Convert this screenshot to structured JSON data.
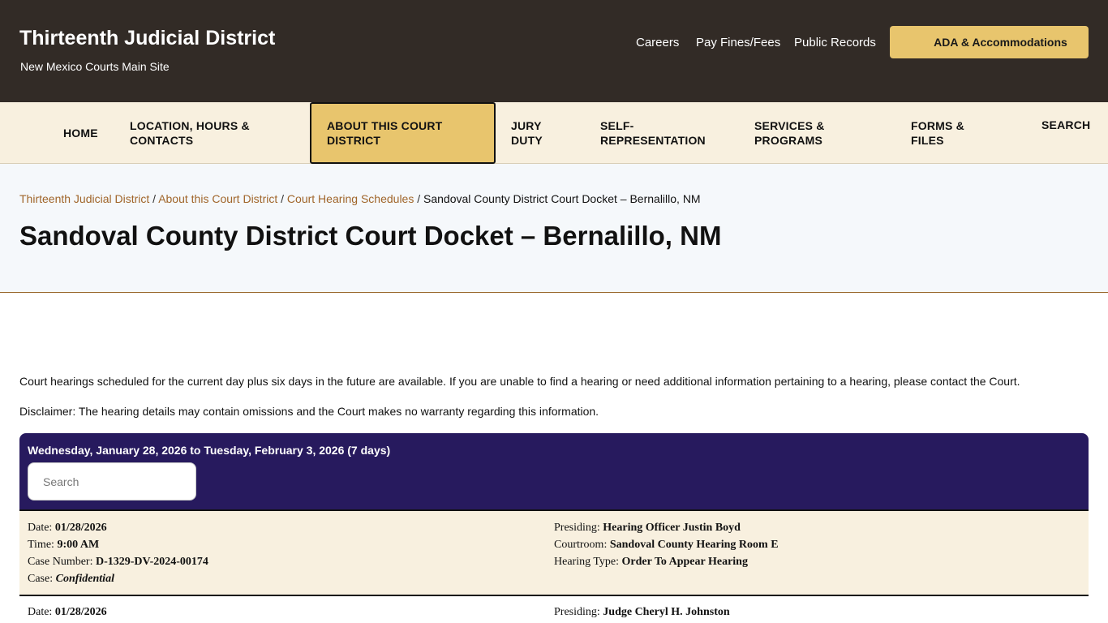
{
  "header": {
    "site_title": "Thirteenth Judicial District",
    "main_site_alt": "New Mexico Courts Main Site",
    "utility_links": [
      "Careers",
      "Pay Fines/Fees",
      "Public Records"
    ],
    "ada_button": "ADA & Accommodations"
  },
  "nav": {
    "items": [
      {
        "label": "HOME"
      },
      {
        "label": "LOCATION, HOURS & CONTACTS"
      },
      {
        "label": "ABOUT THIS COURT DISTRICT",
        "active": true
      },
      {
        "label": "JURY DUTY"
      },
      {
        "label": "SELF-REPRESENTATION"
      },
      {
        "label": "SERVICES & PROGRAMS"
      },
      {
        "label": "FORMS & FILES"
      },
      {
        "label": "SEARCH"
      }
    ]
  },
  "breadcrumb": {
    "links": [
      "Thirteenth Judicial District",
      "About this Court District",
      "Court Hearing Schedules"
    ],
    "current": "Sandoval County District Court Docket – Bernalillo, NM",
    "separator": "/"
  },
  "page_title": "Sandoval County District Court Docket – Bernalillo, NM",
  "content": {
    "intro": "Court hearings scheduled for the current day plus six days in the future are available. If you are unable to find a hearing or need additional information pertaining to a hearing, please contact the Court.",
    "disclaimer": "Disclaimer:  The hearing details may contain omissions and the Court makes no warranty regarding this information."
  },
  "docket": {
    "date_range": "Wednesday, January 28, 2026 to Tuesday, February 3, 2026 (7 days)",
    "search_placeholder": "Search",
    "labels": {
      "date": "Date:",
      "time": "Time:",
      "case_number": "Case Number:",
      "case": "Case:",
      "presiding": "Presiding:",
      "courtroom": "Courtroom:",
      "hearing_type": "Hearing Type:"
    },
    "hearings": [
      {
        "date": "01/28/2026",
        "time": "9:00 AM",
        "case_number": "D-1329-DV-2024-00174",
        "case": "Confidential",
        "presiding": "Hearing Officer Justin Boyd",
        "courtroom": "Sandoval County Hearing Room E",
        "hearing_type": "Order To Appear Hearing"
      },
      {
        "date": "01/28/2026",
        "presiding": "Judge Cheryl H. Johnston"
      }
    ]
  },
  "colors": {
    "header_bg": "#322b26",
    "accent_gold": "#e8c56d",
    "nav_bg": "#f8f0df",
    "docket_bg": "#271a5e",
    "link_color": "#a0652a"
  }
}
